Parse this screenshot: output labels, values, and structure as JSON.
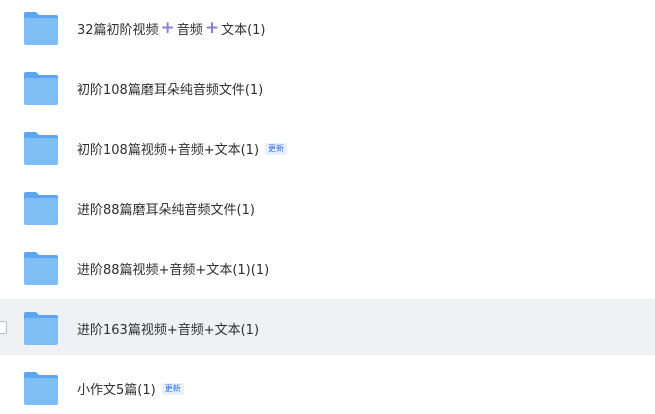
{
  "rows": [
    {
      "parts": [
        "32篇初阶视频",
        "音频",
        "文本(1)"
      ],
      "badge": ""
    },
    {
      "label": "初阶108篇磨耳朵纯音频文件(1)",
      "badge": ""
    },
    {
      "label": "初阶108篇视频+音频+文本(1)",
      "badge": "更新"
    },
    {
      "label": "进阶88篇磨耳朵纯音频文件(1)",
      "badge": ""
    },
    {
      "label": "进阶88篇视频+音频+文本(1)(1)",
      "badge": ""
    },
    {
      "label": "进阶163篇视频+音频+文本(1)",
      "badge": ""
    },
    {
      "label": "小作文5篇(1)",
      "badge": "更新"
    }
  ],
  "icons": {
    "folder": "folder-icon",
    "plus": "plus-icon",
    "checkbox": "checkbox"
  },
  "colors": {
    "folder_front": "#7fbef4",
    "folder_back": "#5da5ee",
    "plus": "#8b7fd6",
    "badge_text": "#2f6fe0",
    "badge_bg": "#e8f0ff",
    "hover_row_bg": "#f0f1f3"
  }
}
